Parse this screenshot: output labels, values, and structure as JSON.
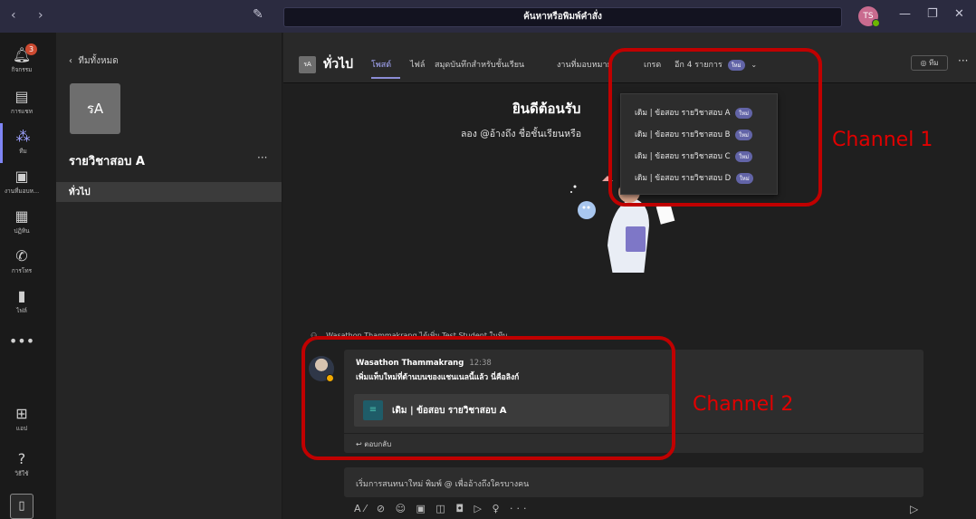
{
  "titlebar": {
    "nav_arrows": "‹  ›",
    "compose_icon": "compose-icon",
    "search_placeholder": "ค้นหาหรือพิมพ์คำสั่ง",
    "user_initials": "TS",
    "minimize": "—",
    "maximize": "❐",
    "close": "✕"
  },
  "rail": {
    "items": [
      {
        "label": "กิจกรรม",
        "icon": "bell-icon",
        "badge": "3"
      },
      {
        "label": "การแชท",
        "icon": "chat-icon"
      },
      {
        "label": "ทีม",
        "icon": "teams-icon"
      },
      {
        "label": "งานที่มอบห...",
        "icon": "assignments-icon"
      },
      {
        "label": "ปฏิทิน",
        "icon": "calendar-icon"
      },
      {
        "label": "การโทร",
        "icon": "phone-icon"
      },
      {
        "label": "ไฟล์",
        "icon": "file-icon"
      },
      {
        "label": "",
        "icon": "more-icon"
      }
    ],
    "apps_label": "แอป",
    "help_label": "วิธีใช้",
    "more_glyph": "•••"
  },
  "team_pane": {
    "back_label": "ทีมทั้งหมด",
    "team_initials": "รA",
    "team_name": "รายวิชาสอบ A",
    "more": "···",
    "channel": "ทั่วไป"
  },
  "header": {
    "tile": "รA",
    "channel_name": "ทั่วไป",
    "tabs": [
      "โพสต์",
      "ไฟล์",
      "สมุดบันทึกสำหรับชั้นเรียน",
      "งานที่มอบหมาย",
      "เกรด"
    ],
    "more_tabs": "อีก 4 รายการ",
    "new_label": "ใหม่",
    "team_button": "◎ ทีม",
    "more": "···"
  },
  "dropdown": {
    "items": [
      "เดิม | ข้อสอบ รายวิชาสอบ A",
      "เดิม | ข้อสอบ รายวิชาสอบ B",
      "เดิม | ข้อสอบ รายวิชาสอบ C",
      "เดิม | ข้อสอบ รายวิชาสอบ D"
    ],
    "new_label": "ใหม่"
  },
  "welcome": {
    "title": "ยินดีต้อนรับ",
    "subtitle": "ลอง @อ้างถึง ชื่อชั้นเรียนหรือ"
  },
  "feed": {
    "system_line": "Wasathon Thammakrang ได้เพิ่ม Test Student ในทีม",
    "post": {
      "author": "Wasathon Thammakrang",
      "time": "12:38",
      "text": "เพิ่มแท็บใหม่ที่ด้านบนของแชนเนลนี้แล้ว นี่คือลิงก์",
      "tab_card_label": "เดิม | ข้อสอบ รายวิชาสอบ A",
      "reply": "ตอบกลับ"
    }
  },
  "compose": {
    "placeholder": "เริ่มการสนทนาใหม่ พิมพ์ @ เพื่ออ้างถึงใครบางคน",
    "toolbar_glyphs": "A⁄ ⊘ ☺ ▣ ◫ ◘ ▷ ♀ ···",
    "send_glyph": "▷"
  },
  "annotations": {
    "label_1": "Channel 1",
    "label_2": "Channel 2",
    "color": "#c00000"
  },
  "colors": {
    "accent": "#7f85f5",
    "new_pill": "#6264a7",
    "presence_available": "#6bb700",
    "presence_away": "#f2a900"
  }
}
